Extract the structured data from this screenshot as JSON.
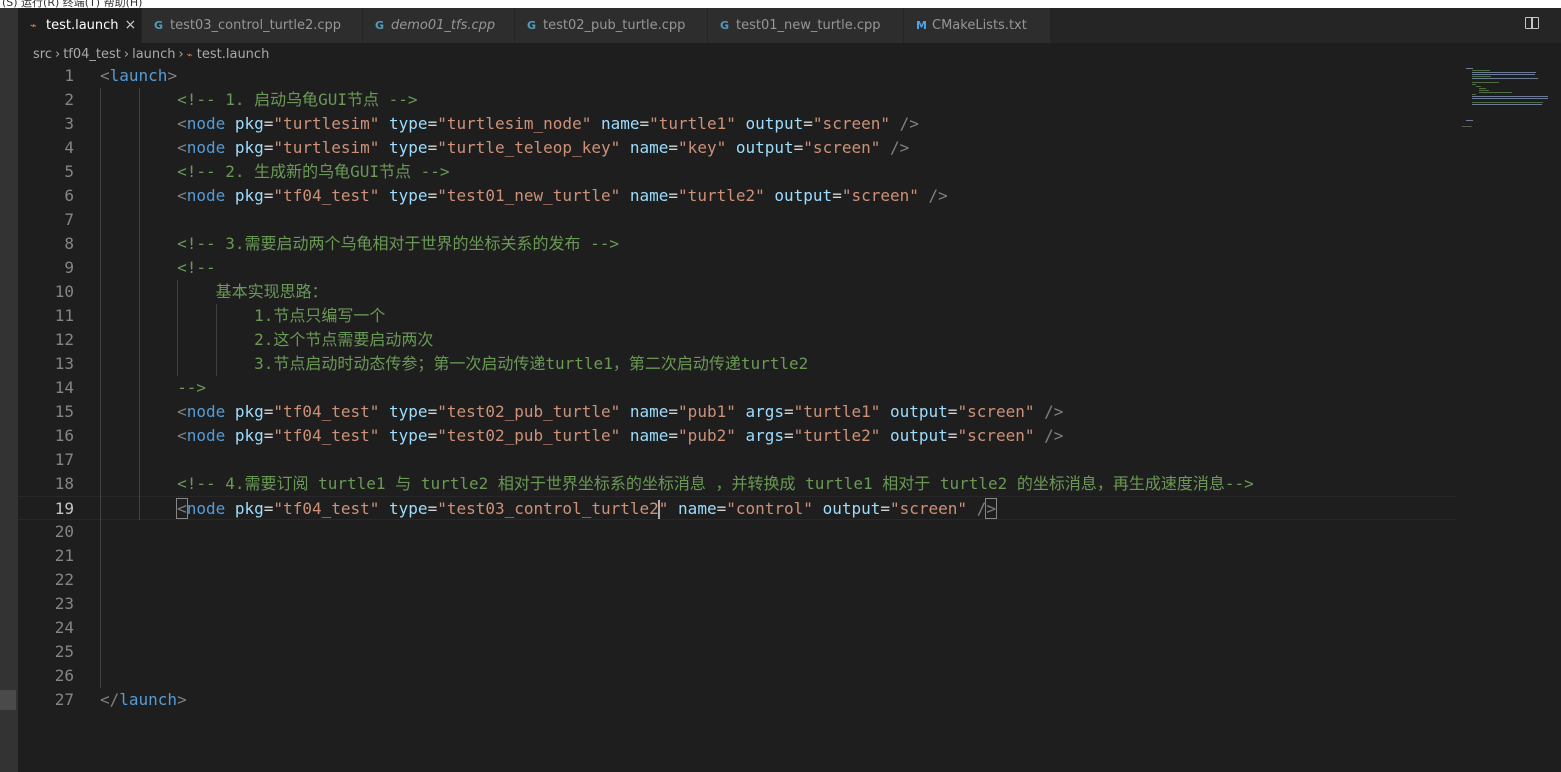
{
  "menubar": {
    "text": "(S)  运行(R)  终端(T)  帮助(H)"
  },
  "tabs": [
    {
      "label": "test.launch",
      "icon": "rss-icon",
      "active": true,
      "italic": false
    },
    {
      "label": "test03_control_turtle2.cpp",
      "icon": "cpp-icon",
      "active": false,
      "italic": false
    },
    {
      "label": "demo01_tfs.cpp",
      "icon": "cpp-icon",
      "active": false,
      "italic": true
    },
    {
      "label": "test02_pub_turtle.cpp",
      "icon": "cpp-icon",
      "active": false,
      "italic": false
    },
    {
      "label": "test01_new_turtle.cpp",
      "icon": "cpp-icon",
      "active": false,
      "italic": false
    },
    {
      "label": "CMakeLists.txt",
      "icon": "cmake-icon",
      "active": false,
      "italic": false
    }
  ],
  "tab_close_glyph": "×",
  "breadcrumb": [
    "src",
    "tf04_test",
    "launch",
    "test.launch"
  ],
  "editor": {
    "current_line": 19,
    "lines": [
      {
        "n": "1",
        "t": "<launch>"
      },
      {
        "n": "2",
        "t": "        <!-- 1. 启动乌龟GUI节点 -->"
      },
      {
        "n": "3",
        "t": "        <node pkg=\"turtlesim\" type=\"turtlesim_node\" name=\"turtle1\" output=\"screen\" />"
      },
      {
        "n": "4",
        "t": "        <node pkg=\"turtlesim\" type=\"turtle_teleop_key\" name=\"key\" output=\"screen\" />"
      },
      {
        "n": "5",
        "t": "        <!-- 2. 生成新的乌龟GUI节点 -->"
      },
      {
        "n": "6",
        "t": "        <node pkg=\"tf04_test\" type=\"test01_new_turtle\" name=\"turtle2\" output=\"screen\" />"
      },
      {
        "n": "7",
        "t": ""
      },
      {
        "n": "8",
        "t": "        <!-- 3.需要启动两个乌龟相对于世界的坐标关系的发布 -->"
      },
      {
        "n": "9",
        "t": "        <!--"
      },
      {
        "n": "10",
        "t": "            基本实现思路："
      },
      {
        "n": "11",
        "t": "                1.节点只编写一个"
      },
      {
        "n": "12",
        "t": "                2.这个节点需要启动两次"
      },
      {
        "n": "13",
        "t": "                3.节点启动时动态传参；第一次启动传递turtle1，第二次启动传递turtle2"
      },
      {
        "n": "14",
        "t": "        -->"
      },
      {
        "n": "15",
        "t": "        <node pkg=\"tf04_test\" type=\"test02_pub_turtle\" name=\"pub1\" args=\"turtle1\" output=\"screen\" />"
      },
      {
        "n": "16",
        "t": "        <node pkg=\"tf04_test\" type=\"test02_pub_turtle\" name=\"pub2\" args=\"turtle2\" output=\"screen\" />"
      },
      {
        "n": "17",
        "t": ""
      },
      {
        "n": "18",
        "t": "        <!-- 4.需要订阅 turtle1 与 turtle2 相对于世界坐标系的坐标消息 ，并转换成 turtle1 相对于 turtle2 的坐标消息，再生成速度消息-->"
      },
      {
        "n": "19",
        "t": "        <node pkg=\"tf04_test\" type=\"test03_control_turtle2\" name=\"control\" output=\"screen\" />"
      },
      {
        "n": "20",
        "t": ""
      },
      {
        "n": "21",
        "t": ""
      },
      {
        "n": "22",
        "t": ""
      },
      {
        "n": "23",
        "t": ""
      },
      {
        "n": "24",
        "t": ""
      },
      {
        "n": "25",
        "t": ""
      },
      {
        "n": "26",
        "t": ""
      },
      {
        "n": "27",
        "t": "</launch>"
      }
    ]
  },
  "colors": {
    "tag": "#569cd6",
    "attribute": "#9cdcfe",
    "string": "#ce9178",
    "comment": "#6a9955",
    "punctuation": "#808080"
  }
}
